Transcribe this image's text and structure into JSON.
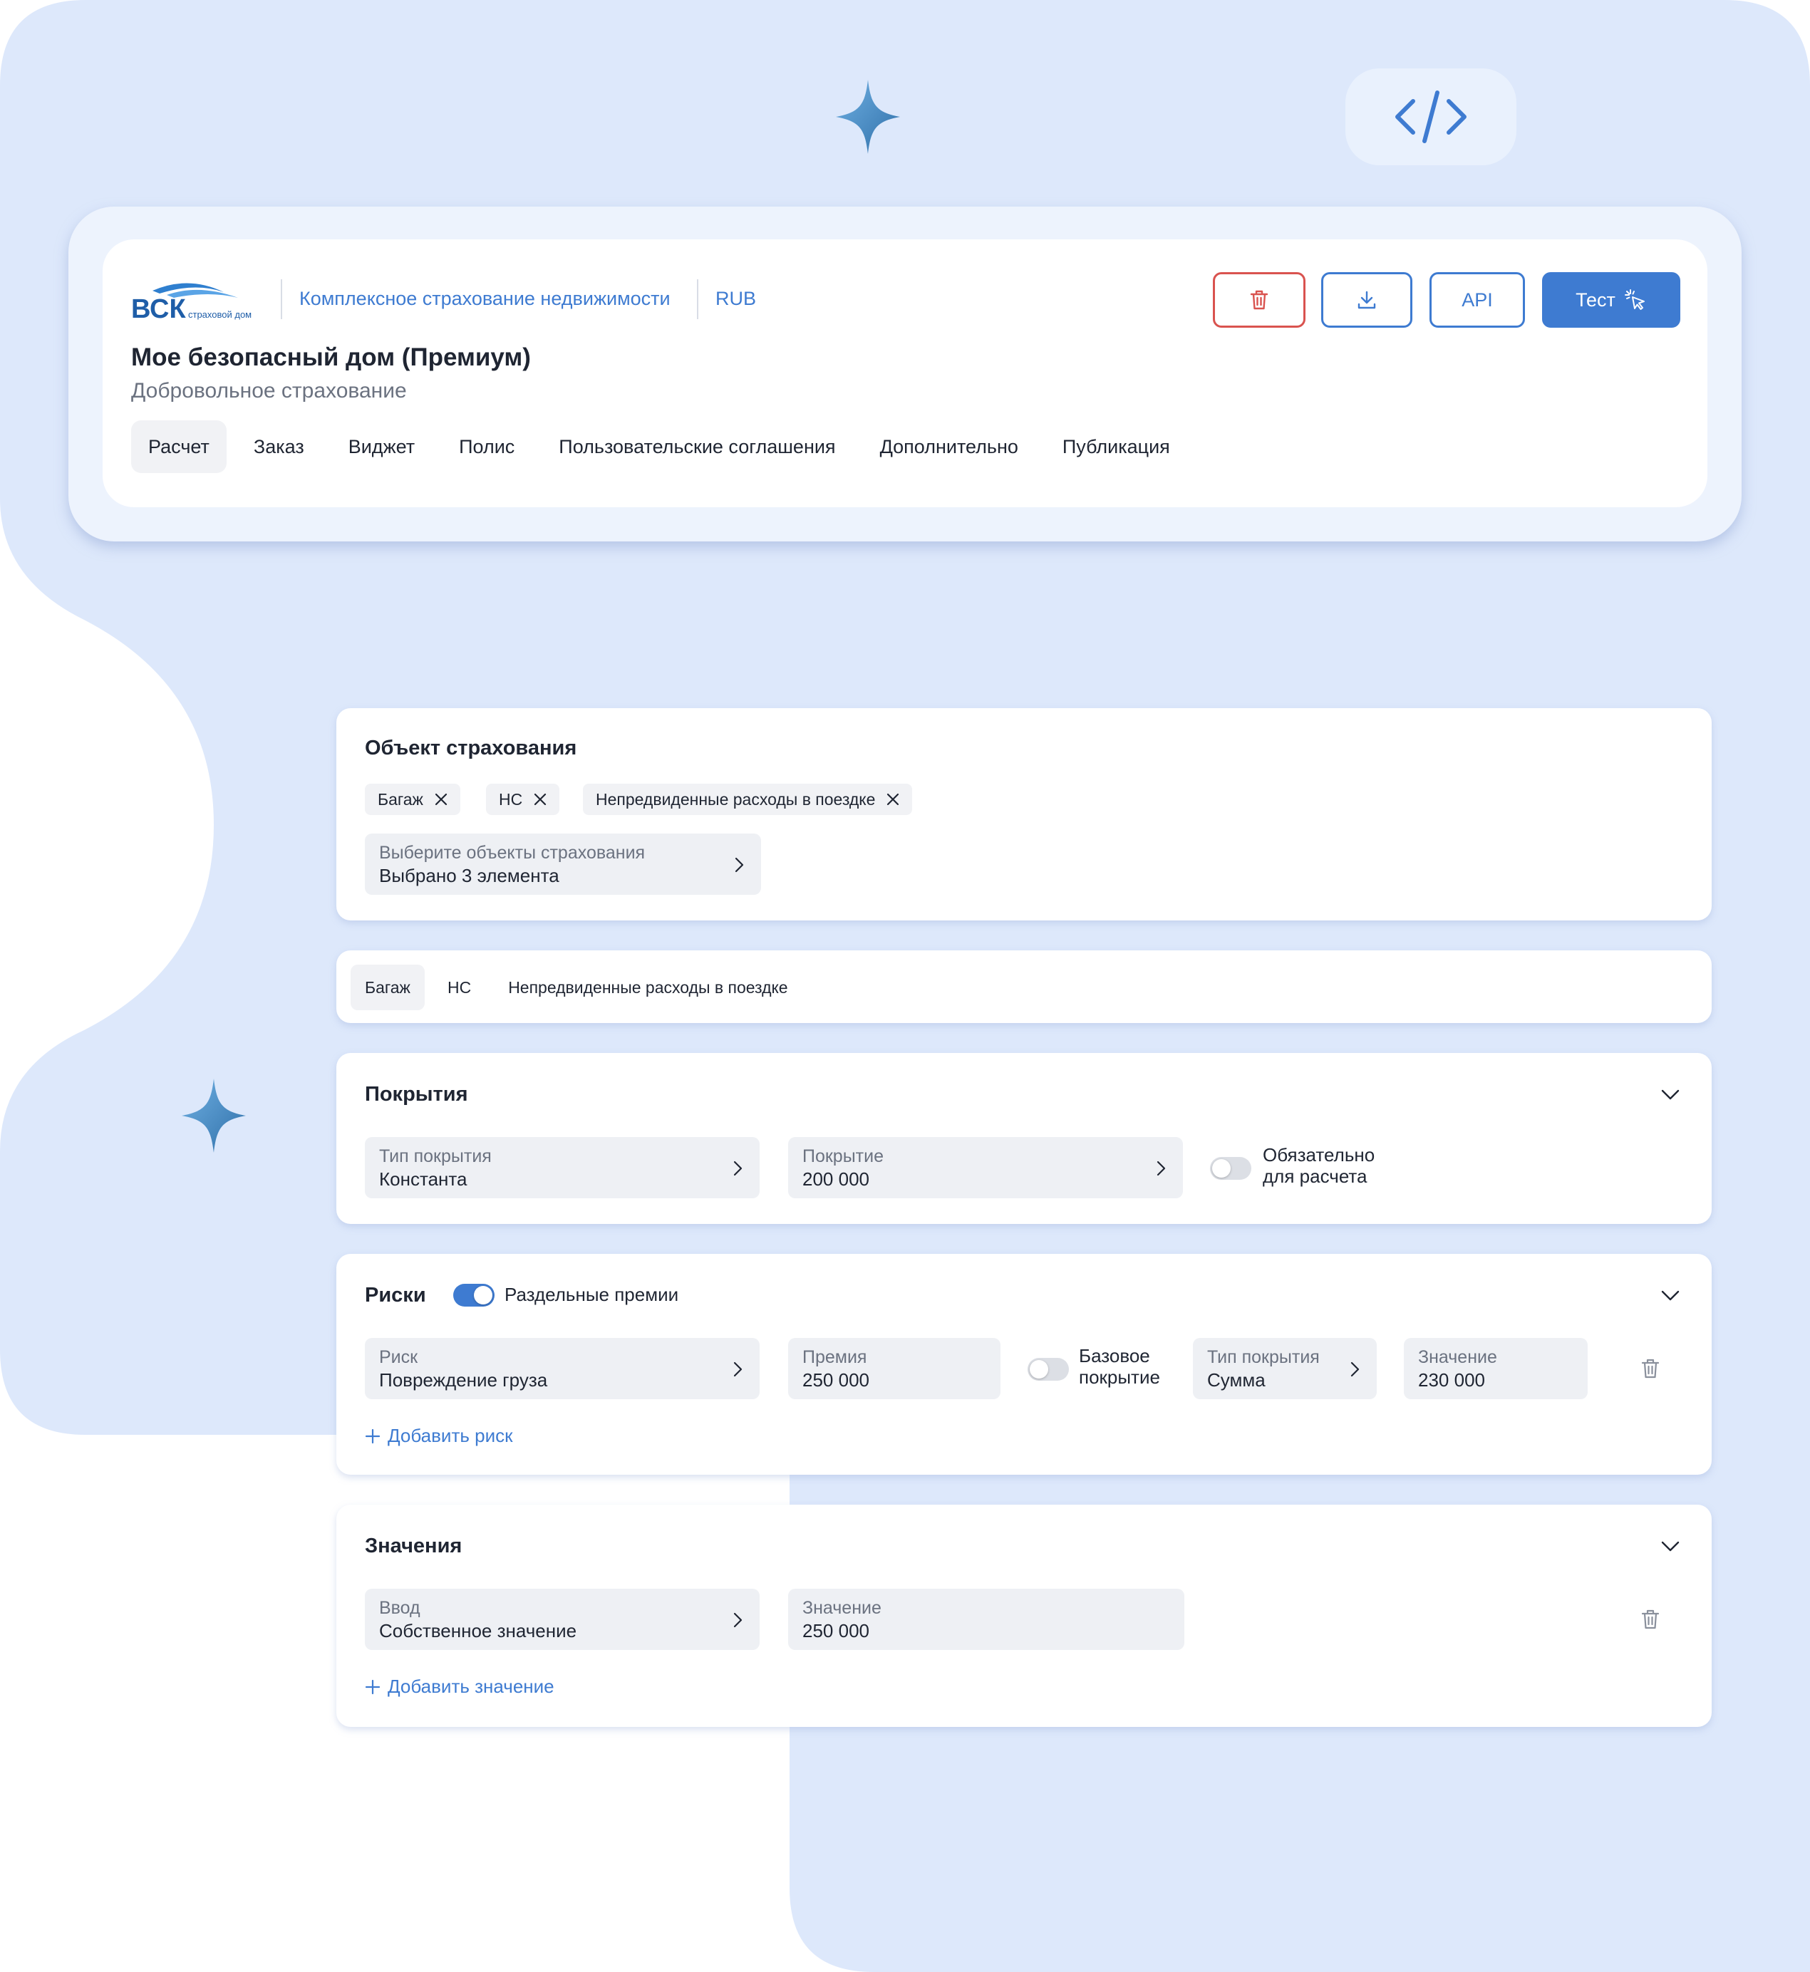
{
  "header": {
    "logo_text": "ВСК",
    "logo_subtext": "страховой дом",
    "product_category": "Комплексное страхование недвижимости",
    "currency": "RUB",
    "title": "Мое безопасный дом (Премиум)",
    "subtitle": "Добровольное страхование",
    "tabs": [
      {
        "label": "Расчет"
      },
      {
        "label": "Заказ"
      },
      {
        "label": "Виджет"
      },
      {
        "label": "Полис"
      },
      {
        "label": "Пользовательские соглашения"
      },
      {
        "label": "Дополнительно"
      },
      {
        "label": "Публикация"
      }
    ],
    "active_tab": "Расчет",
    "buttons": {
      "api_label": "API",
      "test_label": "Тест"
    }
  },
  "insurance_object": {
    "title": "Объект страхования",
    "chips": [
      {
        "label": "Багаж"
      },
      {
        "label": "НС"
      },
      {
        "label": "Непредвиденные расходы в поездке"
      }
    ],
    "select": {
      "placeholder": "Выберите объекты страхования",
      "value": "Выбрано 3 элемента"
    }
  },
  "object_tabs": [
    {
      "label": "Багаж"
    },
    {
      "label": "НС"
    },
    {
      "label": "Непредвиденные расходы в поездке"
    }
  ],
  "coverage": {
    "title": "Покрытия",
    "type_label": "Тип покрытия",
    "type_value": "Константа",
    "amount_label": "Покрытие",
    "amount_value": "200 000",
    "required_toggle_label_1": "Обязательно",
    "required_toggle_label_2": "для расчета",
    "required_toggle_on": false
  },
  "risks": {
    "title": "Риски",
    "separate_premiums_label": "Раздельные премии",
    "separate_premiums_on": true,
    "risk_label": "Риск",
    "risk_value": "Повреждение груза",
    "premium_label": "Премия",
    "premium_value": "250 000",
    "base_cover_label_1": "Базовое",
    "base_cover_label_2": "покрытие",
    "base_cover_on": false,
    "cover_type_label": "Тип покрытия",
    "cover_type_value": "Сумма",
    "value_label": "Значение",
    "value_value": "230 000",
    "add_label": "Добавить риск"
  },
  "values": {
    "title": "Значения",
    "input_label": "Ввод",
    "input_value": "Собственное значение",
    "value_label": "Значение",
    "value_value": "250 000",
    "add_label": "Добавить значение"
  },
  "colors": {
    "accent": "#3e7bd1",
    "danger": "#d9534f",
    "background_blob": "#dce8fb"
  }
}
